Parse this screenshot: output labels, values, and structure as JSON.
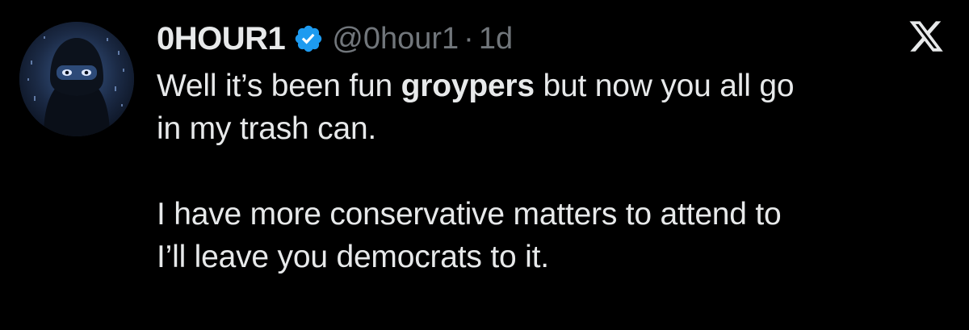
{
  "tweet": {
    "display_name": "0HOUR1",
    "handle": "@0hour1",
    "separator": "·",
    "time": "1d",
    "verified_icon": "verified-badge-icon",
    "platform_icon": "x-logo-icon",
    "avatar": "masked-figure-avatar",
    "body": {
      "line1_pre": "Well it’s been fun ",
      "line1_bold": "groypers",
      "line1_post": " but now you all go",
      "line2": "in my trash can.",
      "line3": "I have more conservative matters to attend to",
      "line4": "I’ll leave you democrats to it."
    },
    "colors": {
      "background": "#000000",
      "text": "#e7e9ea",
      "secondary": "#71767b",
      "verified": "#1d9bf0"
    }
  }
}
